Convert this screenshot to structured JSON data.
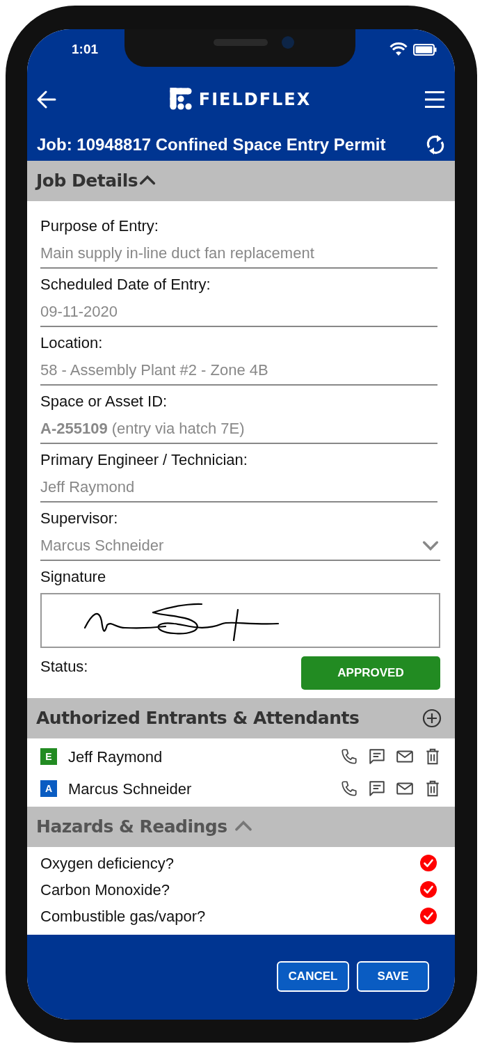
{
  "status_bar": {
    "time": "1:01"
  },
  "app_bar": {
    "logo": "FIELDFLEX"
  },
  "title_bar": {
    "title": "Job: 10948817 Confined Space Entry Permit"
  },
  "job_details": {
    "title": "Job Details",
    "expanded": true,
    "fields": [
      {
        "label": "Purpose of Entry:",
        "value": "Main supply in-line duct fan replacement",
        "kind": "text"
      },
      {
        "label": "Scheduled Date of Entry:",
        "value": "09-11-2020",
        "kind": "text"
      },
      {
        "label": "Location:",
        "value": "58 - Assembly Plant #2 - Zone 4B",
        "kind": "text"
      },
      {
        "label": "Space or Asset ID:",
        "value": "**A-255109** (entry via hatch 7E)",
        "kind": "text"
      },
      {
        "label": "Primary Engineer / Technician:",
        "value": "Jeff Raymond",
        "kind": "text"
      },
      {
        "label": "Supervisor:",
        "value": "Marcus Schneider",
        "kind": "select"
      }
    ],
    "signature": {
      "label": "Signature"
    },
    "status": {
      "label": "Status:",
      "value": "APPROVED"
    }
  },
  "entrants": {
    "title": "Authorized Entrants & Attendants",
    "people": [
      {
        "badge": "E",
        "name": "Jeff Raymond",
        "color": "#228b22"
      },
      {
        "badge": "A",
        "name": "Marcus Schneider",
        "color": "#0a5cc2"
      }
    ]
  },
  "hazards": {
    "title": "Hazards & Readings",
    "expanded": true,
    "items": [
      {
        "label": "Oxygen deficiency?",
        "checked": true
      },
      {
        "label": "Carbon Monoxide?",
        "checked": true
      },
      {
        "label": "Combustible gas/vapor?",
        "checked": true
      }
    ]
  },
  "footer": {
    "buttons": [
      "CANCEL",
      "SAVE"
    ]
  }
}
